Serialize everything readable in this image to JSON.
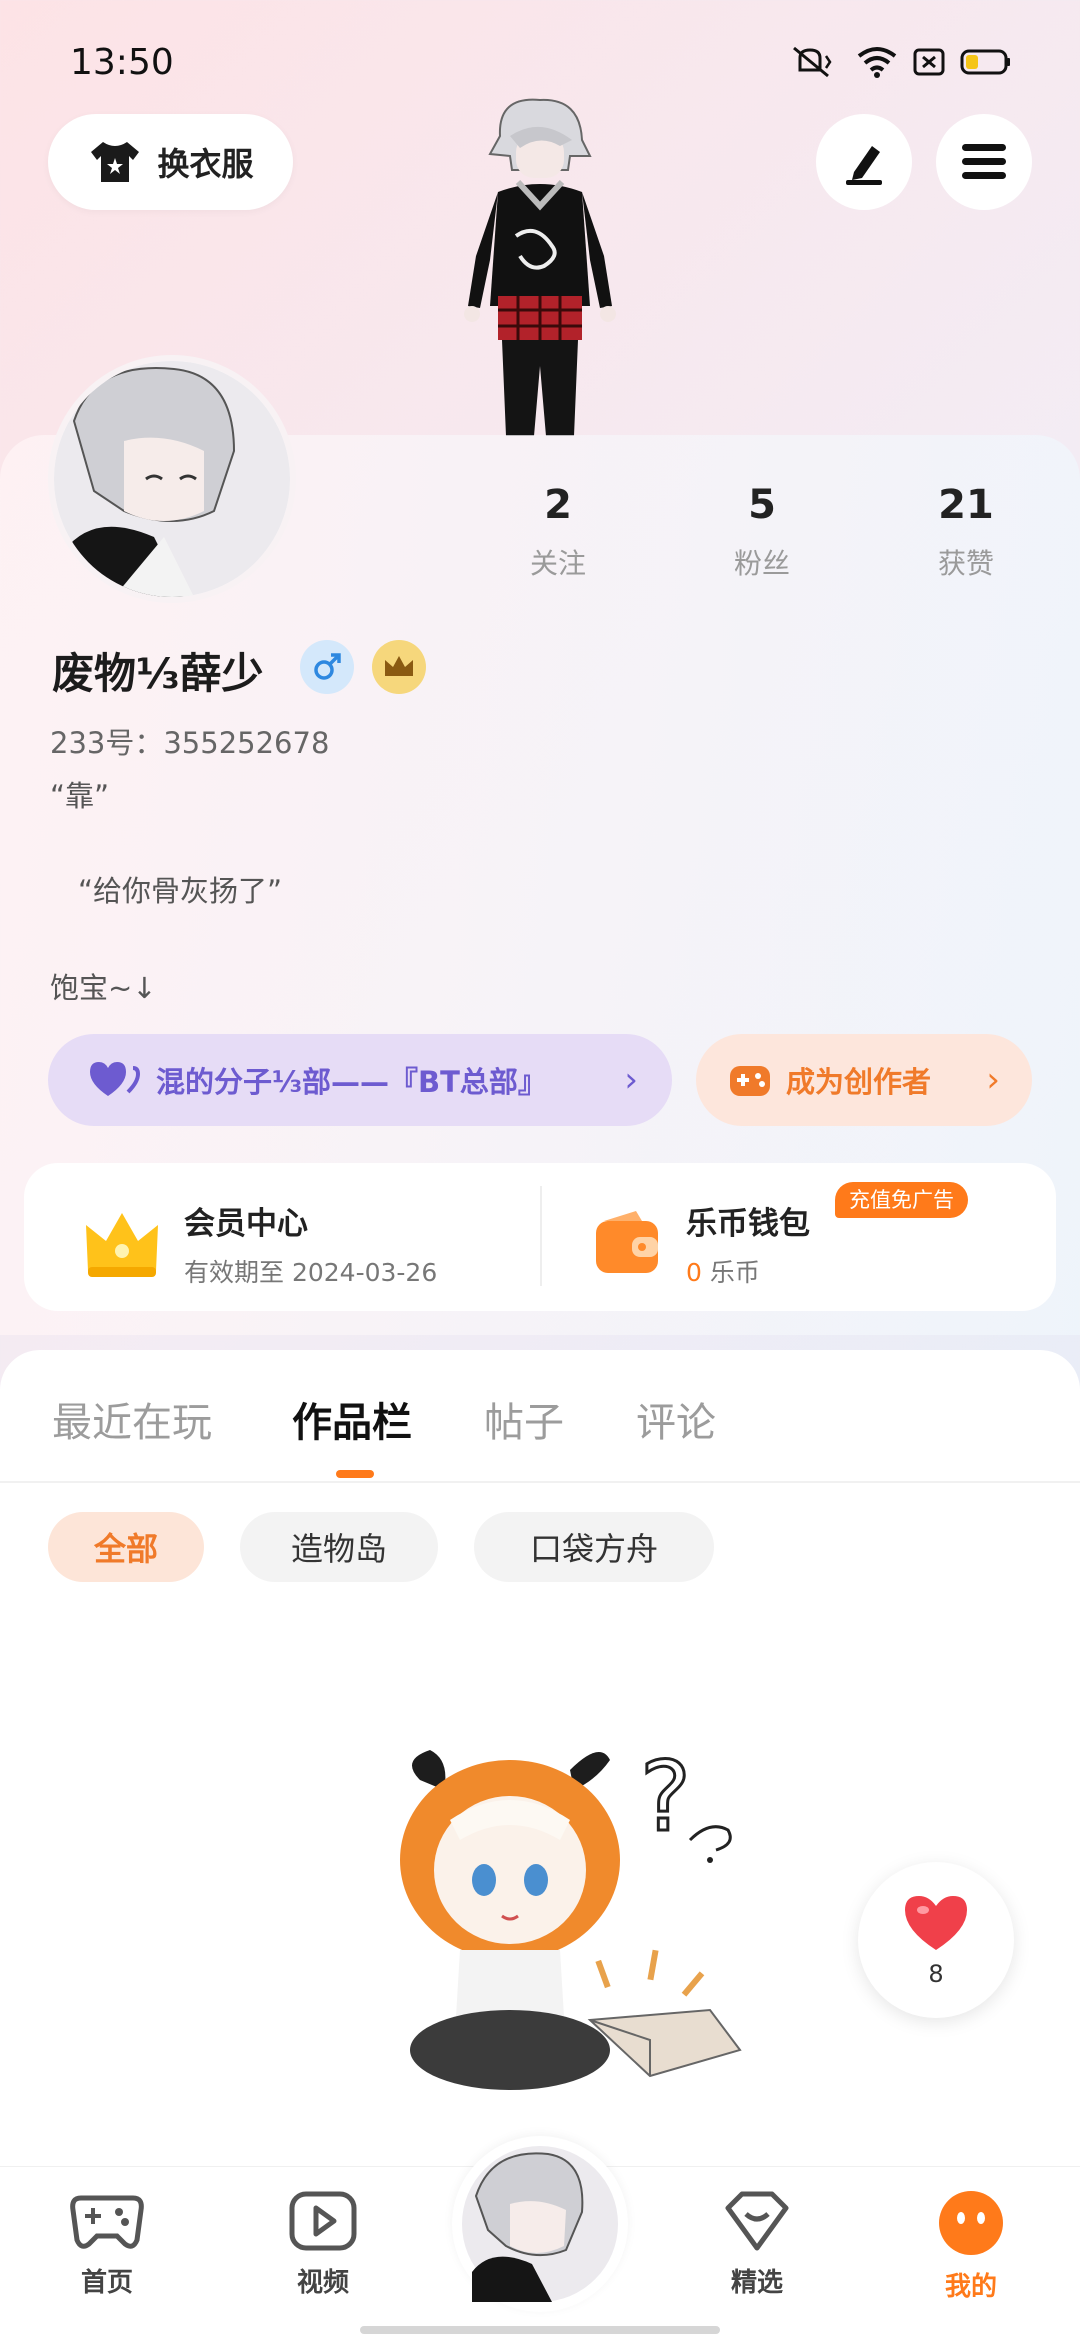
{
  "status_bar": {
    "time": "13:50"
  },
  "header": {
    "outfit_label": "换衣服"
  },
  "profile": {
    "stats": [
      {
        "num": "2",
        "label": "关注"
      },
      {
        "num": "5",
        "label": "粉丝"
      },
      {
        "num": "21",
        "label": "获赞"
      }
    ],
    "username": "废物⅓薛少",
    "id_line": "233号：355252678",
    "bio_lines": [
      "“靠”",
      "“给你骨灰扬了”",
      "饱宝~↓"
    ],
    "group_chip": "混的分子⅓部——『BT总部』",
    "creator_chip": "成为创作者"
  },
  "member": {
    "title": "会员中心",
    "sub": "有效期至 2024-03-26"
  },
  "wallet": {
    "title": "乐币钱包",
    "amount": "0",
    "unit": "乐币",
    "badge": "充值免广告"
  },
  "tabs": [
    "最近在玩",
    "作品栏",
    "帖子",
    "评论"
  ],
  "filters": [
    "全部",
    "造物岛",
    "口袋方舟"
  ],
  "like": {
    "count": "8"
  },
  "nav": [
    "首页",
    "视频",
    "精选",
    "我的"
  ],
  "colors": {
    "accent": "#ff7a1a",
    "purple": "#6d5bd0"
  }
}
